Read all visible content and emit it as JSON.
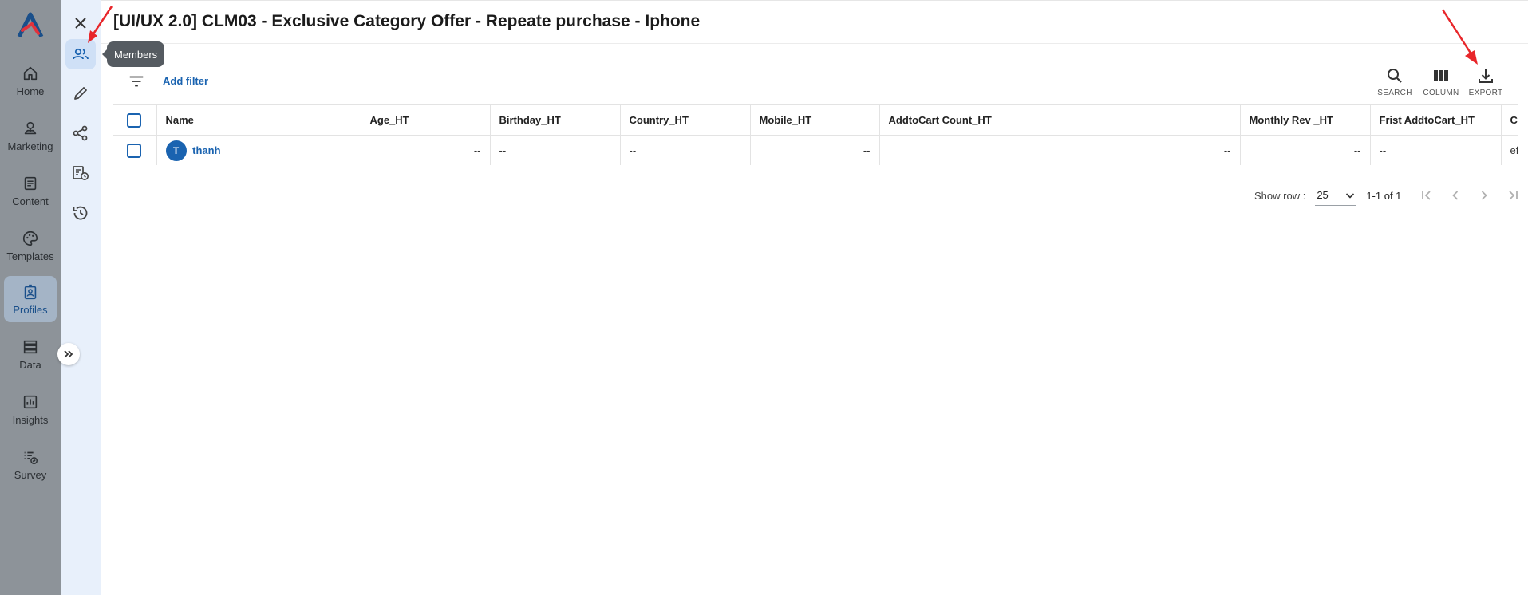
{
  "nav": {
    "items": [
      {
        "label": "Home",
        "icon": "home-icon"
      },
      {
        "label": "Marketing",
        "icon": "marketing-icon"
      },
      {
        "label": "Content",
        "icon": "content-icon"
      },
      {
        "label": "Templates",
        "icon": "palette-icon"
      },
      {
        "label": "Profiles",
        "icon": "profiles-icon",
        "active": true
      },
      {
        "label": "Data",
        "icon": "data-icon"
      },
      {
        "label": "Insights",
        "icon": "insights-icon"
      },
      {
        "label": "Survey",
        "icon": "survey-icon"
      }
    ]
  },
  "rail": {
    "tooltip": "Members"
  },
  "page": {
    "title": "[UI/UX 2.0] CLM03 - Exclusive Category Offer - Repeate purchase - Iphone"
  },
  "toolbar": {
    "add_filter": "Add filter",
    "search_label": "SEARCH",
    "column_label": "COLUMN",
    "export_label": "EXPORT"
  },
  "table": {
    "columns": [
      "Name",
      "Age_HT",
      "Birthday_HT",
      "Country_HT",
      "Mobile_HT",
      "AddtoCart Count_HT",
      "Monthly Rev _HT",
      "Frist AddtoCart_HT",
      "Cu"
    ],
    "rows": [
      {
        "avatar": "T",
        "name": "thanh",
        "cells": [
          "--",
          "--",
          "--",
          "--",
          "--",
          "--",
          "--",
          "efc"
        ]
      }
    ]
  },
  "pagination": {
    "show_row_label": "Show row :",
    "rows_per_page": "25",
    "range": "1-1 of 1"
  },
  "colors": {
    "accent": "#1a63b0",
    "sidebar_bg": "#8d9399",
    "rail_bg": "#e8f0fb",
    "annotation_arrow": "#e8262a"
  }
}
